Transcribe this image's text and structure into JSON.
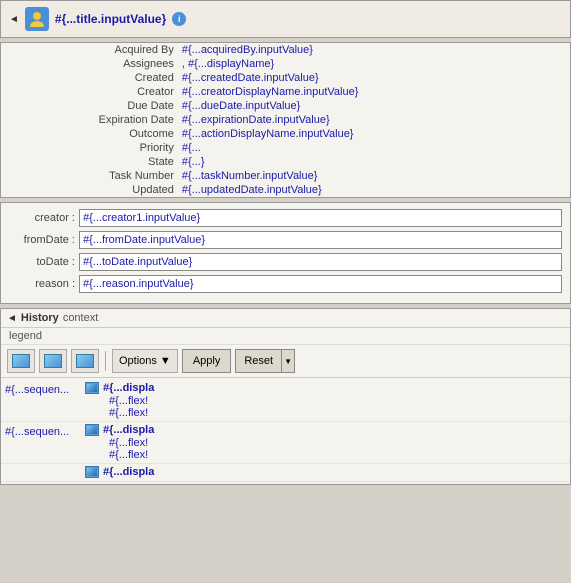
{
  "header": {
    "collapse_arrow": "◄",
    "title": "#{...title.inputValue}",
    "info_label": "i"
  },
  "fields": [
    {
      "label": "Acquired By",
      "value": "#{...acquiredBy.inputValue}"
    },
    {
      "label": "Assignees",
      "value": ", #{...displayName}"
    },
    {
      "label": "Created",
      "value": "#{...createdDate.inputValue}"
    },
    {
      "label": "Creator",
      "value": "#{...creatorDisplayName.inputValue}"
    },
    {
      "label": "Due Date",
      "value": "#{...dueDate.inputValue}"
    },
    {
      "label": "Expiration Date",
      "value": "#{...expirationDate.inputValue}"
    },
    {
      "label": "Outcome",
      "value": "#{...actionDisplayName.inputValue}"
    },
    {
      "label": "Priority",
      "value": "#{..."
    },
    {
      "label": "State",
      "value": "#{...}"
    },
    {
      "label": "Task Number",
      "value": "#{...taskNumber.inputValue}"
    },
    {
      "label": "Updated",
      "value": "#{...updatedDate.inputValue}"
    }
  ],
  "inputs": [
    {
      "label": "creator :",
      "value": "#{...creator1.inputValue}"
    },
    {
      "label": "fromDate :",
      "value": "#{...fromDate.inputValue}"
    },
    {
      "label": "toDate :",
      "value": "#{...toDate.inputValue}"
    },
    {
      "label": "reason :",
      "value": "#{...reason.inputValue}"
    }
  ],
  "history": {
    "title": "History",
    "context_tab": "context",
    "legend_label": "legend",
    "toolbar": {
      "options_label": "Options",
      "options_arrow": "▼",
      "apply_label": "Apply",
      "reset_label": "Reset",
      "reset_arrow": "▼"
    },
    "rows": [
      {
        "sequence": "#{...sequen...",
        "display": "#{...displa",
        "flex1": "#{...flex!",
        "flex2": "#{...flex!"
      },
      {
        "sequence": "#{...sequen...",
        "display": "#{...displa",
        "flex1": "#{...flex!",
        "flex2": "#{...flex!"
      },
      {
        "sequence": "",
        "display": "#{...displa",
        "flex1": "",
        "flex2": ""
      }
    ]
  }
}
